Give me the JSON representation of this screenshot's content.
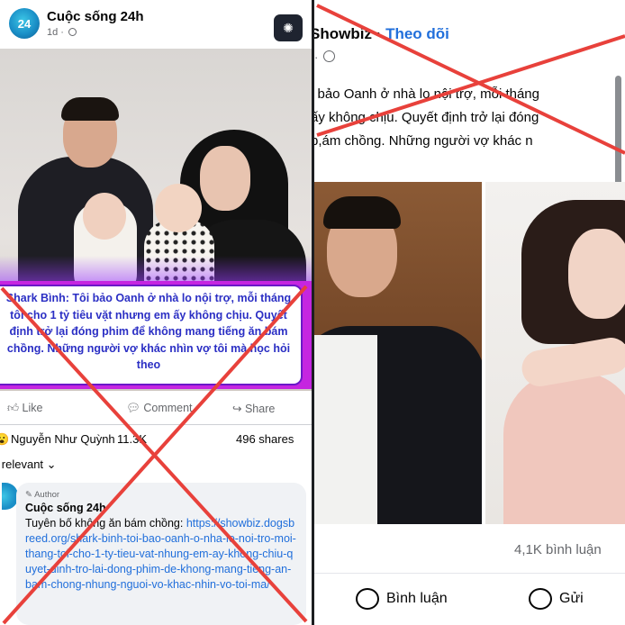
{
  "left_post": {
    "page_name": "Cuộc sống 24h",
    "avatar_text": "24",
    "time": "1d",
    "caption_lead": "Shark Bình:",
    "caption_text": " Tôi bảo Oanh ở nhà lo nội trợ, mỗi tháng tôi cho 1 tỷ tiêu vặt nhưng em ấy không chịu. Quyết định trở lại đóng phim để không mang tiếng ăn bám chồng. Những người vợ khác nhìn vợ tôi mà học hỏi theo",
    "actions": {
      "like": "Like",
      "comment": "Comment",
      "share": "Share"
    },
    "reactions_name": "Nguyễn Như Quỳnh",
    "reactions_count": "11.3K",
    "shares": "496 shares",
    "filter": "Most relevant",
    "comment": {
      "author_badge": "Author",
      "name": "Cuộc sống 24h",
      "text_prefix": "Tuyên bố không ăn bám chồng: ",
      "link": "https://showbiz.dogsbreed.org/shark-binh-toi-bao-oanh-o-nha-lo-noi-tro-moi-thang-toi-cho-1-ty-tieu-vat-nhung-em-ay-khong-chiu-quyet-dinh-tro-lai-dong-phim-de-khong-mang-tieng-an-bam-chong-nhung-nguoi-vo-khac-nhin-vo-toi-ma/"
    }
  },
  "right_post": {
    "page_name": "Showbiz",
    "follow": "Theo dõi",
    "separator": " · ",
    "body_line1": "i bảo Oanh ở nhà lo nội trợ, mỗi tháng",
    "body_line2": "ấy không chịu. Quyết định trở lại đóng",
    "body_line3": "b,ám chồng. Những người vợ khác n",
    "comments_count": "4,1K bình luận",
    "actions": {
      "comment": "Bình luận",
      "share": "Gửi"
    }
  },
  "colors": {
    "cross": "#e8413b",
    "link": "#216fdb",
    "caption": "#2b2fc4",
    "purple": "#c526e0"
  }
}
